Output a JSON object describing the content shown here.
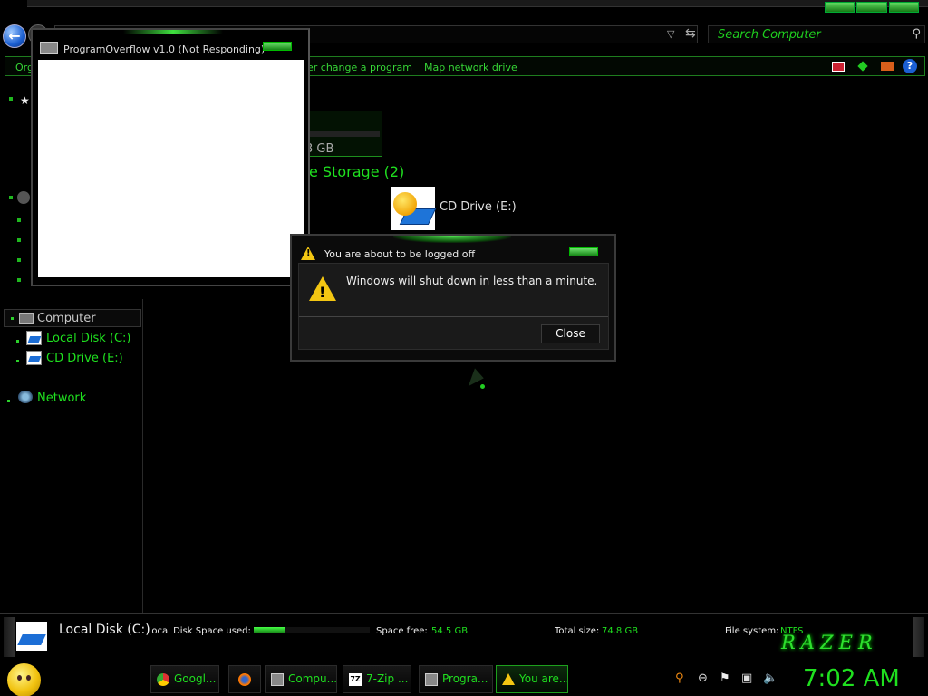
{
  "search": {
    "placeholder": "Search Computer"
  },
  "commandbar": {
    "organize_label": "Org",
    "uninstall_label": "er change a program",
    "map_drive_label": "Map network drive"
  },
  "navigation": {
    "computer_label": "Computer",
    "local_disk_label": "Local Disk (C:)",
    "cd_drive_label": "CD Drive (E:)",
    "network_label": "Network"
  },
  "content": {
    "drive_size_partial": "3 GB",
    "removable_heading": "e Storage (2)",
    "cd_drive_label": "CD Drive (E:)"
  },
  "not_responding_window": {
    "title": "ProgramOverflow v1.0 (Not Responding)"
  },
  "logoff_dialog": {
    "title": "You are about to be logged off",
    "message": "Windows will shut down in less than a minute.",
    "close_label": "Close",
    "icon": "warning-icon"
  },
  "details": {
    "drive_name": "Local Disk (C:)",
    "space_used_label": "Local Disk Space used:",
    "space_used_fraction": 0.27,
    "space_free_label": "Space free:",
    "space_free_value": "54.5 GB",
    "total_size_label": "Total size:",
    "total_size_value": "74.8 GB",
    "file_system_label": "File system:",
    "file_system_value": "NTFS",
    "brand": "RAZER"
  },
  "taskbar": {
    "items": [
      {
        "label": "Googl...",
        "icon": "chrome-icon"
      },
      {
        "label": "",
        "icon": "firefox-icon"
      },
      {
        "label": "Compu...",
        "icon": "computer-icon"
      },
      {
        "label": "7-Zip ...",
        "icon": "7zip-icon",
        "icon_text": "7Z"
      },
      {
        "label": "Progra...",
        "icon": "program-icon"
      },
      {
        "label": "You are...",
        "icon": "warning-icon",
        "active": true
      }
    ],
    "clock": "7:02 AM"
  },
  "colors": {
    "accent_green": "#1fe01f",
    "warning_yellow": "#f3c612"
  }
}
